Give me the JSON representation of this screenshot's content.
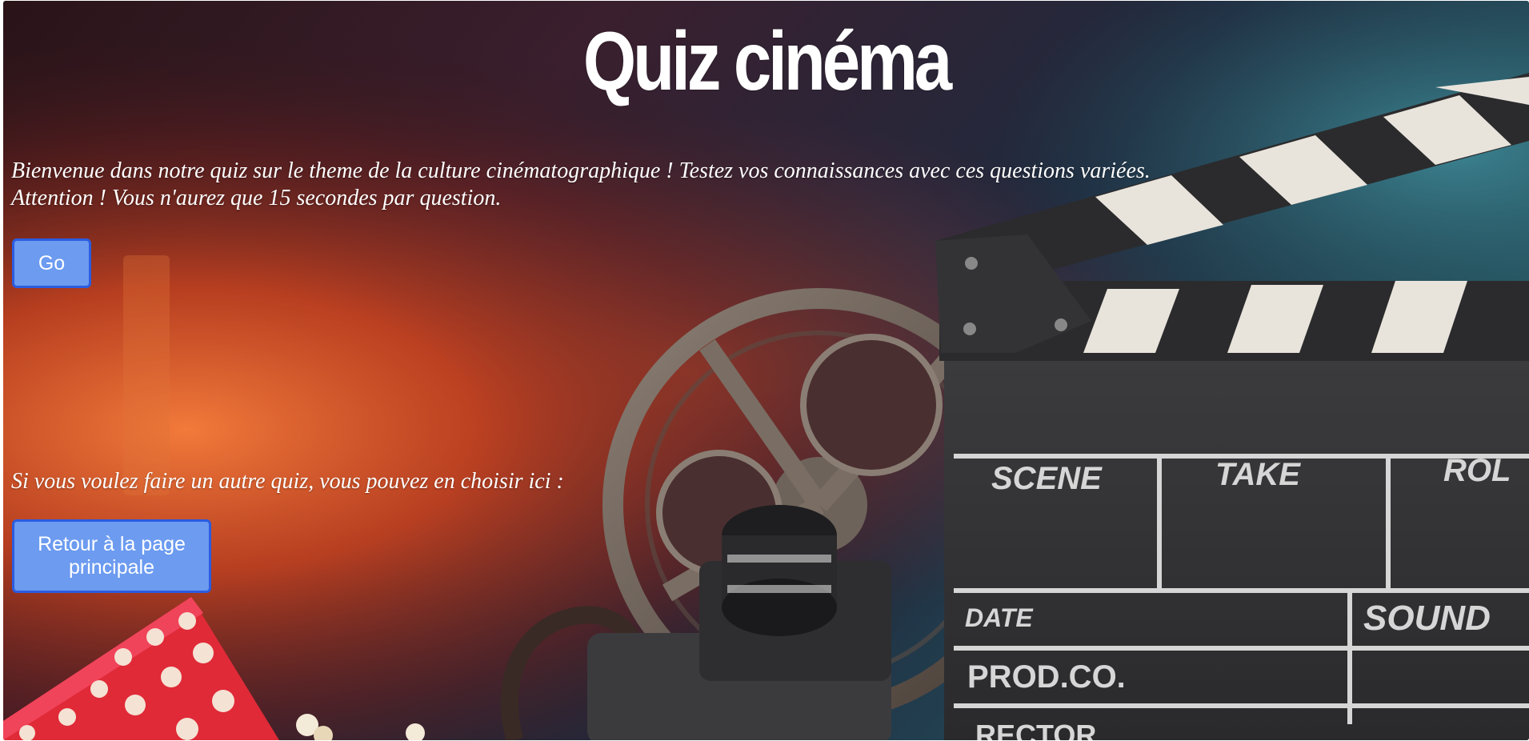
{
  "page": {
    "title": "Quiz cinéma",
    "intro_line1": "Bienvenue dans notre quiz sur le theme de la culture cinématographique ! Testez vos connaissances avec ces questions variées.",
    "intro_line2": "Attention ! Vous n'aurez que 15 secondes par question.",
    "go_label": "Go",
    "other_quiz_text": "Si vous voulez faire un autre quiz, vous pouvez en choisir ici :",
    "back_label": "Retour à la page principale"
  },
  "background": {
    "clapperboard_labels": {
      "scene": "SCENE",
      "take": "TAKE",
      "roll": "ROL",
      "date": "DATE",
      "sound": "SOUND",
      "prod": "PROD.CO.",
      "director": "RECTOR"
    }
  },
  "colors": {
    "button_fill": "#6c9bf0",
    "button_border": "#2b5ce0",
    "text": "#ffffff"
  }
}
